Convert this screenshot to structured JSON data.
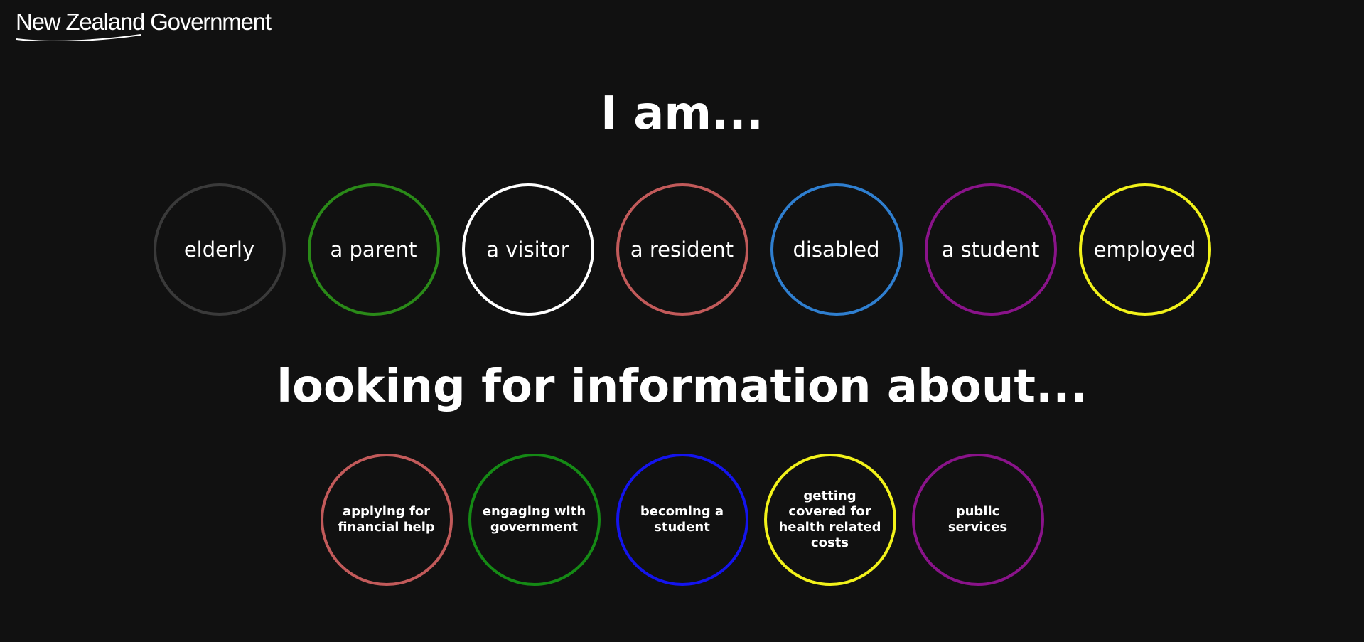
{
  "brand": {
    "logo_text": "New Zealand Government"
  },
  "headings": {
    "who": "I am...",
    "what": "looking for information about..."
  },
  "personas": [
    {
      "label": "elderly",
      "color": "#3a3a3a"
    },
    {
      "label": "a parent",
      "color": "#2a8a18"
    },
    {
      "label": "a visitor",
      "color": "#ffffff"
    },
    {
      "label": "a resident",
      "color": "#c25a5a"
    },
    {
      "label": "disabled",
      "color": "#2f7fd0"
    },
    {
      "label": "a student",
      "color": "#8a138a"
    },
    {
      "label": "employed",
      "color": "#f2f21a"
    }
  ],
  "topics": [
    {
      "label": "applying for financial help",
      "color": "#c25a5a"
    },
    {
      "label": "engaging with government",
      "color": "#158a15"
    },
    {
      "label": "becoming a student",
      "color": "#1414ee"
    },
    {
      "label": "getting covered for health related costs",
      "color": "#f2f21a"
    },
    {
      "label": "public services",
      "color": "#8a138a"
    }
  ]
}
